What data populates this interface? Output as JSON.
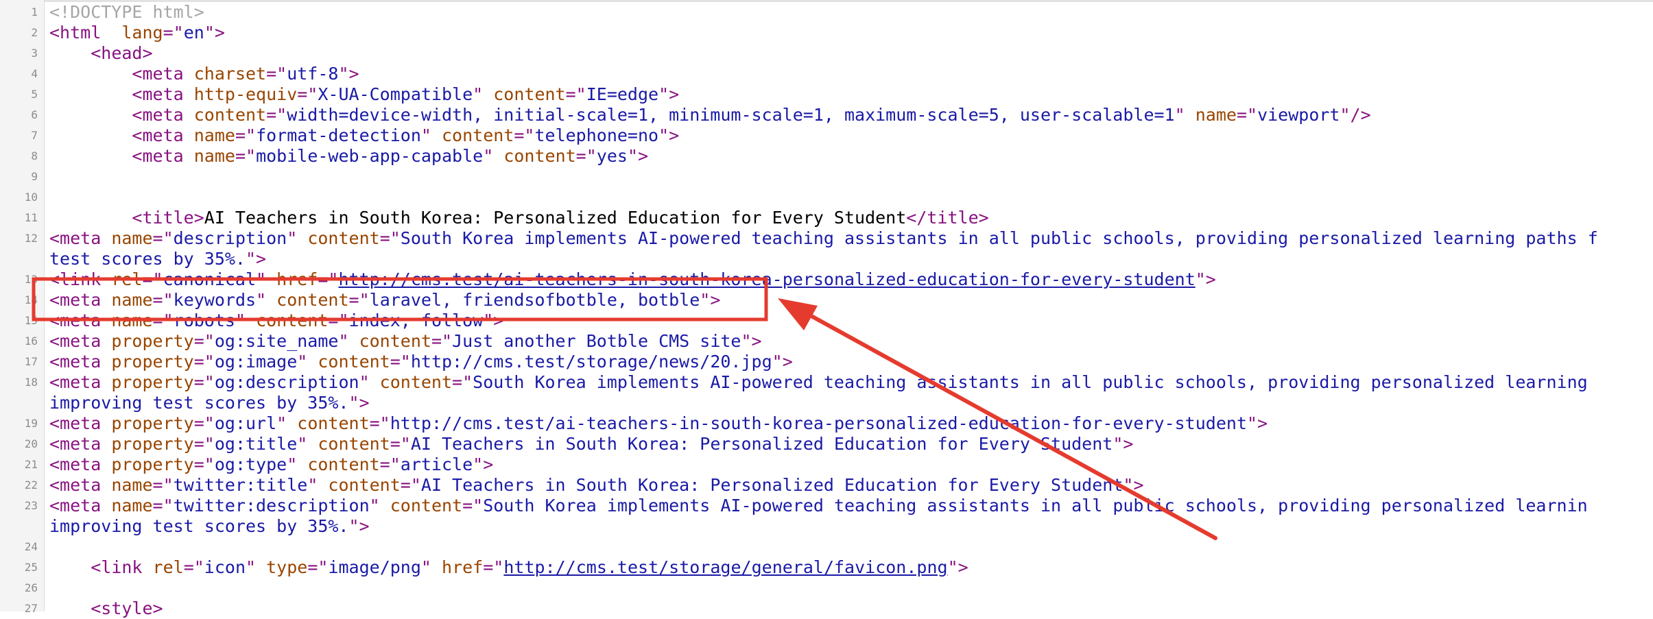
{
  "lines": [
    {
      "n": "1",
      "indent": "",
      "tokens": [
        {
          "c": "c",
          "t": "<!DOCTYPE html>"
        }
      ]
    },
    {
      "n": "2",
      "indent": "",
      "tokens": [
        {
          "c": "t",
          "t": "<html"
        },
        {
          "c": "tx",
          "t": "  "
        },
        {
          "c": "a",
          "t": "lang"
        },
        {
          "c": "t",
          "t": "=\""
        },
        {
          "c": "v",
          "t": "en"
        },
        {
          "c": "t",
          "t": "\">"
        }
      ]
    },
    {
      "n": "3",
      "indent": "    ",
      "tokens": [
        {
          "c": "t",
          "t": "<head>"
        }
      ]
    },
    {
      "n": "4",
      "indent": "        ",
      "tokens": [
        {
          "c": "t",
          "t": "<meta "
        },
        {
          "c": "a",
          "t": "charset"
        },
        {
          "c": "t",
          "t": "=\""
        },
        {
          "c": "v",
          "t": "utf-8"
        },
        {
          "c": "t",
          "t": "\">"
        }
      ]
    },
    {
      "n": "5",
      "indent": "        ",
      "tokens": [
        {
          "c": "t",
          "t": "<meta "
        },
        {
          "c": "a",
          "t": "http-equiv"
        },
        {
          "c": "t",
          "t": "=\""
        },
        {
          "c": "v",
          "t": "X-UA-Compatible"
        },
        {
          "c": "t",
          "t": "\" "
        },
        {
          "c": "a",
          "t": "content"
        },
        {
          "c": "t",
          "t": "=\""
        },
        {
          "c": "v",
          "t": "IE=edge"
        },
        {
          "c": "t",
          "t": "\">"
        }
      ]
    },
    {
      "n": "6",
      "indent": "        ",
      "tokens": [
        {
          "c": "t",
          "t": "<meta "
        },
        {
          "c": "a",
          "t": "content"
        },
        {
          "c": "t",
          "t": "=\""
        },
        {
          "c": "v",
          "t": "width=device-width, initial-scale=1, minimum-scale=1, maximum-scale=5, user-scalable=1"
        },
        {
          "c": "t",
          "t": "\" "
        },
        {
          "c": "a",
          "t": "name"
        },
        {
          "c": "t",
          "t": "=\""
        },
        {
          "c": "v",
          "t": "viewport"
        },
        {
          "c": "t",
          "t": "\"/>"
        }
      ]
    },
    {
      "n": "7",
      "indent": "        ",
      "tokens": [
        {
          "c": "t",
          "t": "<meta "
        },
        {
          "c": "a",
          "t": "name"
        },
        {
          "c": "t",
          "t": "=\""
        },
        {
          "c": "v",
          "t": "format-detection"
        },
        {
          "c": "t",
          "t": "\" "
        },
        {
          "c": "a",
          "t": "content"
        },
        {
          "c": "t",
          "t": "=\""
        },
        {
          "c": "v",
          "t": "telephone=no"
        },
        {
          "c": "t",
          "t": "\">"
        }
      ]
    },
    {
      "n": "8",
      "indent": "        ",
      "tokens": [
        {
          "c": "t",
          "t": "<meta "
        },
        {
          "c": "a",
          "t": "name"
        },
        {
          "c": "t",
          "t": "=\""
        },
        {
          "c": "v",
          "t": "mobile-web-app-capable"
        },
        {
          "c": "t",
          "t": "\" "
        },
        {
          "c": "a",
          "t": "content"
        },
        {
          "c": "t",
          "t": "=\""
        },
        {
          "c": "v",
          "t": "yes"
        },
        {
          "c": "t",
          "t": "\">"
        }
      ]
    },
    {
      "n": "9",
      "indent": "",
      "tokens": []
    },
    {
      "n": "10",
      "indent": "",
      "tokens": []
    },
    {
      "n": "11",
      "indent": "        ",
      "tokens": [
        {
          "c": "t",
          "t": "<title>"
        },
        {
          "c": "tx",
          "t": "AI Teachers in South Korea: Personalized Education for Every Student"
        },
        {
          "c": "t",
          "t": "</title>"
        }
      ]
    },
    {
      "n": "12",
      "indent": "",
      "tokens": [
        {
          "c": "t",
          "t": "<meta "
        },
        {
          "c": "a",
          "t": "name"
        },
        {
          "c": "t",
          "t": "=\""
        },
        {
          "c": "v",
          "t": "description"
        },
        {
          "c": "t",
          "t": "\" "
        },
        {
          "c": "a",
          "t": "content"
        },
        {
          "c": "t",
          "t": "=\""
        },
        {
          "c": "v",
          "t": "South Korea implements AI-powered teaching assistants in all public schools, providing personalized learning paths f"
        }
      ]
    },
    {
      "n": "",
      "indent": "",
      "tokens": [
        {
          "c": "v",
          "t": "test scores by 35%."
        },
        {
          "c": "t",
          "t": "\">"
        }
      ]
    },
    {
      "n": "13",
      "indent": "",
      "tokens": [
        {
          "c": "t",
          "t": "<link "
        },
        {
          "c": "a",
          "t": "rel"
        },
        {
          "c": "t",
          "t": "=\""
        },
        {
          "c": "v",
          "t": "canonical"
        },
        {
          "c": "t",
          "t": "\" "
        },
        {
          "c": "a",
          "t": "href"
        },
        {
          "c": "t",
          "t": "=\""
        },
        {
          "c": "lk",
          "t": "http://cms.test/ai-teachers-in-south-korea-personalized-education-for-every-student"
        },
        {
          "c": "t",
          "t": "\">"
        }
      ]
    },
    {
      "n": "14",
      "indent": "",
      "tokens": [
        {
          "c": "t",
          "t": "<meta "
        },
        {
          "c": "a",
          "t": "name"
        },
        {
          "c": "t",
          "t": "=\""
        },
        {
          "c": "v",
          "t": "keywords"
        },
        {
          "c": "t",
          "t": "\" "
        },
        {
          "c": "a",
          "t": "content"
        },
        {
          "c": "t",
          "t": "=\""
        },
        {
          "c": "v",
          "t": "laravel, friendsofbotble, botble"
        },
        {
          "c": "t",
          "t": "\">"
        }
      ]
    },
    {
      "n": "15",
      "indent": "",
      "tokens": [
        {
          "c": "t",
          "t": "<meta "
        },
        {
          "c": "a",
          "t": "name"
        },
        {
          "c": "t",
          "t": "=\""
        },
        {
          "c": "v",
          "t": "robots"
        },
        {
          "c": "t",
          "t": "\" "
        },
        {
          "c": "a",
          "t": "content"
        },
        {
          "c": "t",
          "t": "=\""
        },
        {
          "c": "v",
          "t": "index, follow"
        },
        {
          "c": "t",
          "t": "\">"
        }
      ]
    },
    {
      "n": "16",
      "indent": "",
      "tokens": [
        {
          "c": "t",
          "t": "<meta "
        },
        {
          "c": "a",
          "t": "property"
        },
        {
          "c": "t",
          "t": "=\""
        },
        {
          "c": "v",
          "t": "og:site_name"
        },
        {
          "c": "t",
          "t": "\" "
        },
        {
          "c": "a",
          "t": "content"
        },
        {
          "c": "t",
          "t": "=\""
        },
        {
          "c": "v",
          "t": "Just another Botble CMS site"
        },
        {
          "c": "t",
          "t": "\">"
        }
      ]
    },
    {
      "n": "17",
      "indent": "",
      "tokens": [
        {
          "c": "t",
          "t": "<meta "
        },
        {
          "c": "a",
          "t": "property"
        },
        {
          "c": "t",
          "t": "=\""
        },
        {
          "c": "v",
          "t": "og:image"
        },
        {
          "c": "t",
          "t": "\" "
        },
        {
          "c": "a",
          "t": "content"
        },
        {
          "c": "t",
          "t": "=\""
        },
        {
          "c": "v",
          "t": "http://cms.test/storage/news/20.jpg"
        },
        {
          "c": "t",
          "t": "\">"
        }
      ]
    },
    {
      "n": "18",
      "indent": "",
      "tokens": [
        {
          "c": "t",
          "t": "<meta "
        },
        {
          "c": "a",
          "t": "property"
        },
        {
          "c": "t",
          "t": "=\""
        },
        {
          "c": "v",
          "t": "og:description"
        },
        {
          "c": "t",
          "t": "\" "
        },
        {
          "c": "a",
          "t": "content"
        },
        {
          "c": "t",
          "t": "=\""
        },
        {
          "c": "v",
          "t": "South Korea implements AI-powered teaching assistants in all public schools, providing personalized learning"
        }
      ]
    },
    {
      "n": "",
      "indent": "",
      "tokens": [
        {
          "c": "v",
          "t": "improving test scores by 35%."
        },
        {
          "c": "t",
          "t": "\">"
        }
      ]
    },
    {
      "n": "19",
      "indent": "",
      "tokens": [
        {
          "c": "t",
          "t": "<meta "
        },
        {
          "c": "a",
          "t": "property"
        },
        {
          "c": "t",
          "t": "=\""
        },
        {
          "c": "v",
          "t": "og:url"
        },
        {
          "c": "t",
          "t": "\" "
        },
        {
          "c": "a",
          "t": "content"
        },
        {
          "c": "t",
          "t": "=\""
        },
        {
          "c": "v",
          "t": "http://cms.test/ai-teachers-in-south-korea-personalized-education-for-every-student"
        },
        {
          "c": "t",
          "t": "\">"
        }
      ]
    },
    {
      "n": "20",
      "indent": "",
      "tokens": [
        {
          "c": "t",
          "t": "<meta "
        },
        {
          "c": "a",
          "t": "property"
        },
        {
          "c": "t",
          "t": "=\""
        },
        {
          "c": "v",
          "t": "og:title"
        },
        {
          "c": "t",
          "t": "\" "
        },
        {
          "c": "a",
          "t": "content"
        },
        {
          "c": "t",
          "t": "=\""
        },
        {
          "c": "v",
          "t": "AI Teachers in South Korea: Personalized Education for Every Student"
        },
        {
          "c": "t",
          "t": "\">"
        }
      ]
    },
    {
      "n": "21",
      "indent": "",
      "tokens": [
        {
          "c": "t",
          "t": "<meta "
        },
        {
          "c": "a",
          "t": "property"
        },
        {
          "c": "t",
          "t": "=\""
        },
        {
          "c": "v",
          "t": "og:type"
        },
        {
          "c": "t",
          "t": "\" "
        },
        {
          "c": "a",
          "t": "content"
        },
        {
          "c": "t",
          "t": "=\""
        },
        {
          "c": "v",
          "t": "article"
        },
        {
          "c": "t",
          "t": "\">"
        }
      ]
    },
    {
      "n": "22",
      "indent": "",
      "tokens": [
        {
          "c": "t",
          "t": "<meta "
        },
        {
          "c": "a",
          "t": "name"
        },
        {
          "c": "t",
          "t": "=\""
        },
        {
          "c": "v",
          "t": "twitter:title"
        },
        {
          "c": "t",
          "t": "\" "
        },
        {
          "c": "a",
          "t": "content"
        },
        {
          "c": "t",
          "t": "=\""
        },
        {
          "c": "v",
          "t": "AI Teachers in South Korea: Personalized Education for Every Student"
        },
        {
          "c": "t",
          "t": "\">"
        }
      ]
    },
    {
      "n": "23",
      "indent": "",
      "tokens": [
        {
          "c": "t",
          "t": "<meta "
        },
        {
          "c": "a",
          "t": "name"
        },
        {
          "c": "t",
          "t": "=\""
        },
        {
          "c": "v",
          "t": "twitter:description"
        },
        {
          "c": "t",
          "t": "\" "
        },
        {
          "c": "a",
          "t": "content"
        },
        {
          "c": "t",
          "t": "=\""
        },
        {
          "c": "v",
          "t": "South Korea implements AI-powered teaching assistants in all public schools, providing personalized learnin"
        }
      ]
    },
    {
      "n": "",
      "indent": "",
      "tokens": [
        {
          "c": "v",
          "t": "improving test scores by 35%."
        },
        {
          "c": "t",
          "t": "\">"
        }
      ]
    },
    {
      "n": "24",
      "indent": "",
      "tokens": []
    },
    {
      "n": "25",
      "indent": "    ",
      "tokens": [
        {
          "c": "t",
          "t": "<link "
        },
        {
          "c": "a",
          "t": "rel"
        },
        {
          "c": "t",
          "t": "=\""
        },
        {
          "c": "v",
          "t": "icon"
        },
        {
          "c": "t",
          "t": "\" "
        },
        {
          "c": "a",
          "t": "type"
        },
        {
          "c": "t",
          "t": "=\""
        },
        {
          "c": "v",
          "t": "image/png"
        },
        {
          "c": "t",
          "t": "\" "
        },
        {
          "c": "a",
          "t": "href"
        },
        {
          "c": "t",
          "t": "=\""
        },
        {
          "c": "lk",
          "t": "http://cms.test/storage/general/favicon.png"
        },
        {
          "c": "t",
          "t": "\">"
        }
      ]
    },
    {
      "n": "26",
      "indent": "",
      "tokens": []
    },
    {
      "n": "27",
      "indent": "    ",
      "tokens": [
        {
          "c": "t",
          "t": "<style>"
        }
      ]
    }
  ],
  "annotation": {
    "highlight_line": "14",
    "color": "#e53b2f"
  }
}
